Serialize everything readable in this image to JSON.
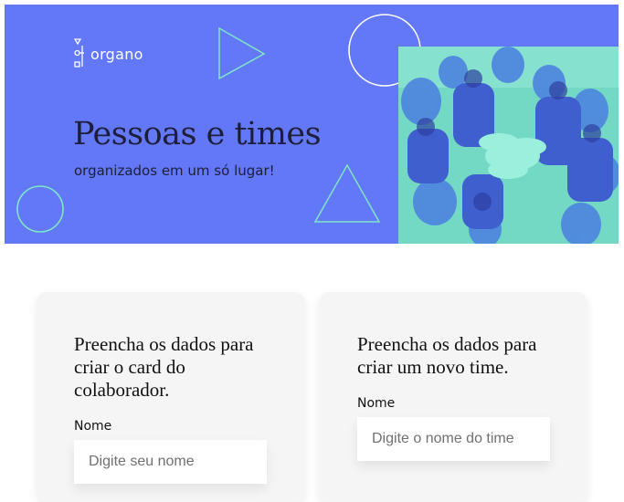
{
  "banner": {
    "logo_text": "organo",
    "title": "Pessoas e times",
    "subtitle": "organizados em um só lugar!",
    "background_color": "#6278f7",
    "accent_color": "#7fe6c8"
  },
  "forms": {
    "collaborator": {
      "heading_line1": "Preencha os dados para",
      "heading_line2": "criar o card do",
      "heading_line3": "colaborador.",
      "name_label": "Nome",
      "name_placeholder": "Digite seu nome"
    },
    "team": {
      "heading_line1": "Preencha os dados para",
      "heading_line2": "criar um novo time.",
      "name_label": "Nome",
      "name_placeholder": "Digite o nome do time"
    }
  }
}
